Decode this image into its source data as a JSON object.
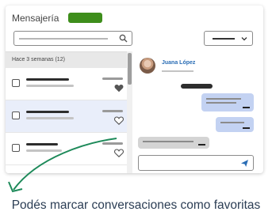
{
  "app": {
    "title": "Mensajería",
    "accent_color": "#3e8e1b"
  },
  "search": {
    "icon": "search-icon"
  },
  "filter": {
    "icon": "chevron-down-icon"
  },
  "conversation_list": {
    "section_label": "Hace 3 semanas (12)",
    "rows": [
      {
        "favorite": true,
        "selected": false
      },
      {
        "favorite": false,
        "selected": true
      },
      {
        "favorite": false,
        "selected": false
      },
      {
        "favorite": false,
        "selected": false
      }
    ]
  },
  "chat": {
    "contact_name": "Juana López",
    "send_icon": "send-icon",
    "outgoing_bubble_color": "#c3d2f2",
    "incoming_bubble_color": "#d4d4d4"
  },
  "caption": {
    "text": "Podés marcar conversaciones como favoritas",
    "color": "#2c3e55",
    "arrow_color": "#1e8a5a"
  }
}
